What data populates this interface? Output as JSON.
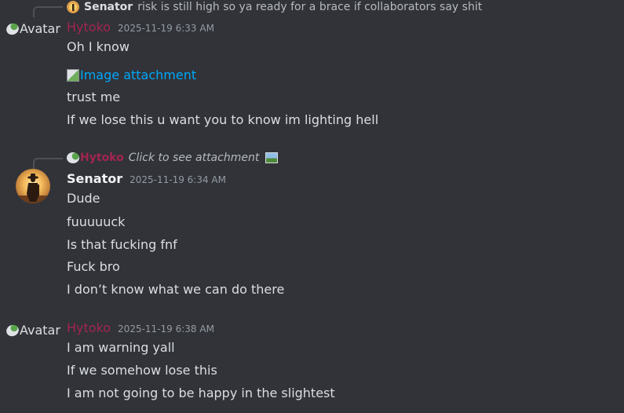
{
  "messages": [
    {
      "reply": {
        "author": "Senator",
        "text": "risk is still high so ya ready for a brace if collaborators say shit"
      },
      "author": "Hytoko",
      "timestamp": "2025-11-19 6:33 AM",
      "avatar_alt": "Avatar",
      "attachment_alt": "Image attachment",
      "lines": [
        "Oh I know",
        "trust me",
        "If we lose this u want you to know im lighting hell"
      ]
    },
    {
      "reply": {
        "author": "Hytoko",
        "text": "Click to see attachment"
      },
      "author": "Senator",
      "timestamp": "2025-11-19 6:34 AM",
      "lines": [
        "Dude",
        "fuuuuuck",
        "Is that fucking fnf",
        "Fuck bro",
        "I don’t know what we can do there"
      ]
    },
    {
      "author": "Hytoko",
      "timestamp": "2025-11-19 6:38 AM",
      "avatar_alt": "Avatar",
      "lines": [
        "I am warning yall",
        "If we somehow lose this",
        "I am not going to be happy in the slightest"
      ]
    }
  ],
  "colors": {
    "background": "#313338",
    "hytoko_name": "#a3254f",
    "link": "#00a8fc",
    "timestamp": "#949ba4"
  }
}
